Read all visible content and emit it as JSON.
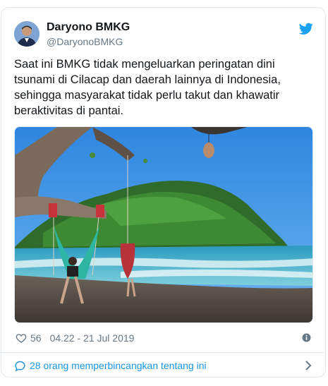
{
  "author": {
    "name": "Daryono BMKG",
    "handle": "@DaryonoBMKG",
    "avatar_icon": "profile-photo"
  },
  "tweet": {
    "text": "Saat ini BMKG tidak mengeluarkan peringatan dini tsunami di Cilacap dan daerah lainnya di Indonesia, sehingga masyarakat tidak perlu takut dan khawatir beraktivitas di pantai.",
    "media_icon": "beach-photo"
  },
  "meta": {
    "likes": "56",
    "timestamp": "04.22 - 21 Jul 2019"
  },
  "footer": {
    "discussion_label": "28 orang memperbincangkan tentang ini"
  },
  "colors": {
    "twitter_blue": "#1da1f2",
    "link_blue": "#1b95e0",
    "secondary_text": "#657786",
    "border": "#e1e8ed"
  }
}
